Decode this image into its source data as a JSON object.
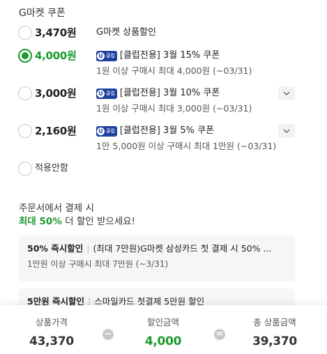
{
  "section_title": "G마켓 쿠폰",
  "options": [
    {
      "price": "3,470원",
      "title": "G마켓 상품할인",
      "sub": "",
      "club_badge": false
    },
    {
      "price": "4,000원",
      "title": "[클럽전용] 3월 15% 쿠폰",
      "sub": "1원 이상 구매시 최대 4,000원 (~03/31)",
      "club_badge": true
    },
    {
      "price": "3,000원",
      "title": "[클럽전용] 3월 10% 쿠폰",
      "sub": "1원 이상 구매시 최대 3,000원 (~03/31)",
      "club_badge": true
    },
    {
      "price": "2,160원",
      "title": "[클럽전용] 3월 5% 쿠폰",
      "sub": "1만 5,000원 이상 구매시 최대 1만원 (~03/31)",
      "club_badge": true
    }
  ],
  "not_apply_label": "적용안함",
  "badge": {
    "u": "U",
    "text": "클럽"
  },
  "promo": {
    "line1": "주문서에서 결제 시",
    "highlight": "최대 50%",
    "line2_rest": " 더 할인 받으세요!"
  },
  "cards": [
    {
      "strong": "50% 즉시할인",
      "rest": "(최대 7만원)G마켓 삼성카드 첫 결제 시 50% ...",
      "sub": "1만원 이상 구매시 최대 7만원 (~3/31)"
    },
    {
      "strong": "5만원 즉시할인",
      "rest": "스마일카드 첫결제 5만원 할인",
      "sub": ""
    }
  ],
  "footer": {
    "product_price_label": "상품가격",
    "product_price": "43,370",
    "minus": "−",
    "discount_label": "할인금액",
    "discount": "4,000",
    "equals": "=",
    "total_label": "총 상품금액",
    "total": "39,370"
  },
  "colors": {
    "accent": "#1a9a2e",
    "club_badge": "#1d3fa0"
  }
}
